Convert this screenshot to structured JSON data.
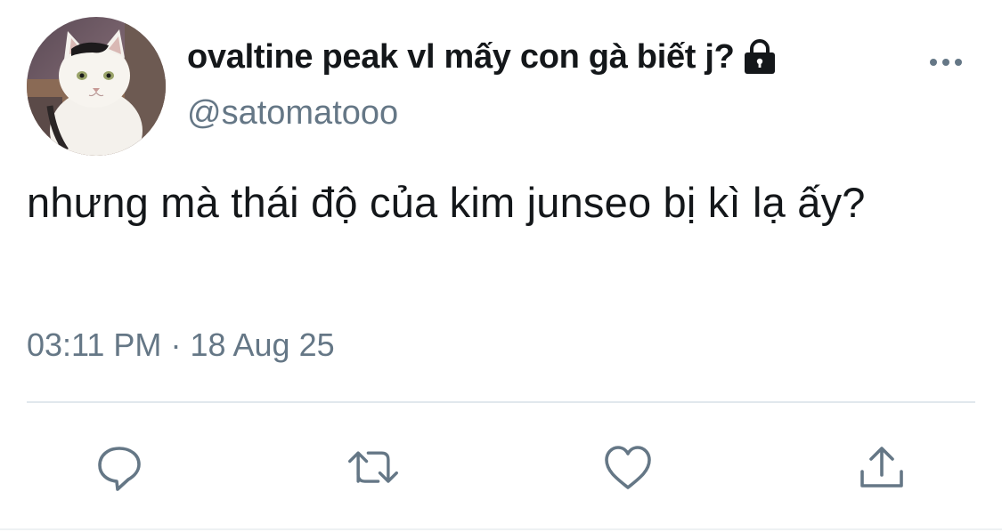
{
  "tweet": {
    "display_name": "ovaltine peak vl mấy con gà biết j?",
    "handle": "@satomatooo",
    "text": "nhưng mà thái độ của kim junseo bị kì lạ ấy?",
    "time": "03:11 PM",
    "separator": "·",
    "date": "18 Aug 25",
    "protected": true
  },
  "icons": {
    "avatar": "cat-photo-avatar",
    "lock": "lock-icon",
    "more": "more-options-icon",
    "reply": "reply-icon",
    "retweet": "retweet-icon",
    "like": "heart-icon",
    "share": "share-icon"
  },
  "colors": {
    "text_primary": "#14171a",
    "text_secondary": "#657786",
    "icon": "#657786",
    "divider": "#e1e8ed"
  }
}
